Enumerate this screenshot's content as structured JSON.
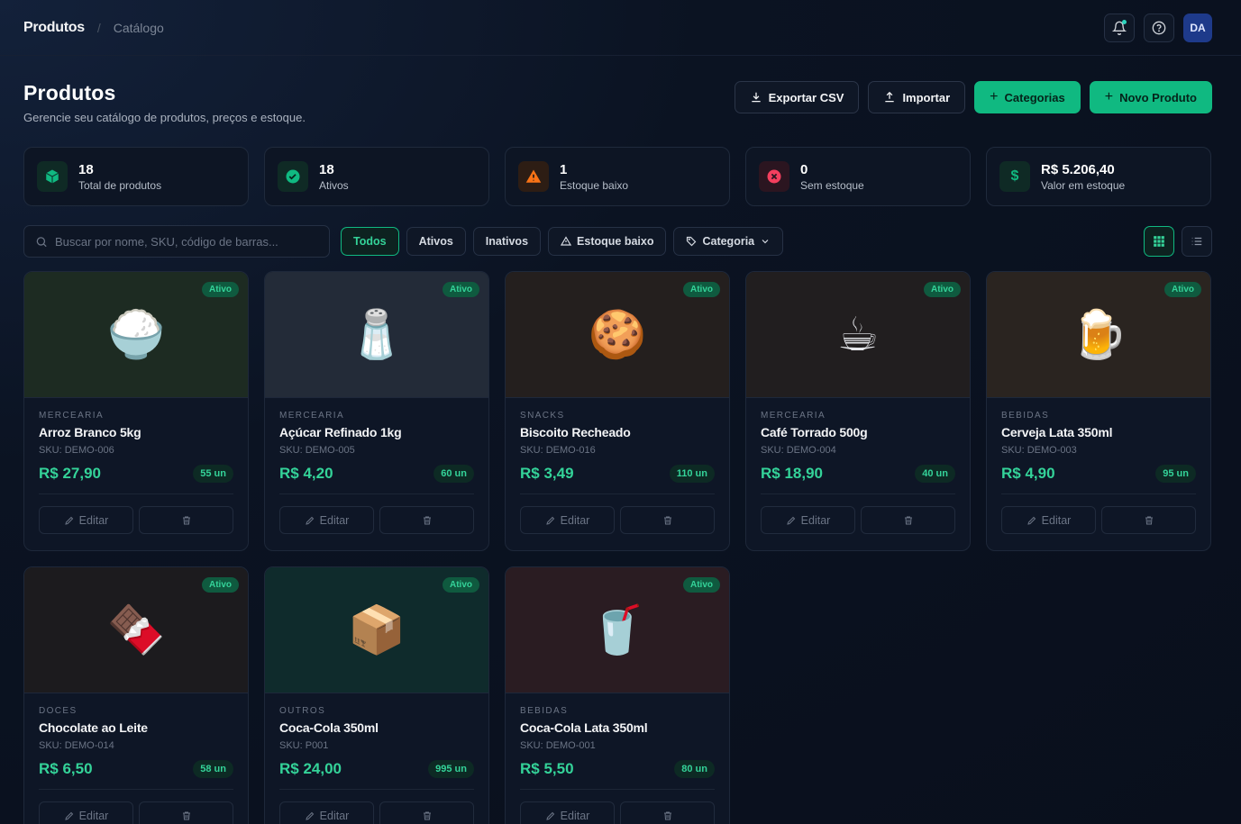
{
  "topbar": {
    "breadcrumb_main": "Produtos",
    "breadcrumb_separator": "/",
    "breadcrumb_sub": "Catálogo",
    "avatar_initials": "DA"
  },
  "header": {
    "title": "Produtos",
    "subtitle": "Gerencie seu catálogo de produtos, preços e estoque.",
    "export_label": "Exportar CSV",
    "import_label": "Importar",
    "categories_label": "Categorias",
    "new_product_label": "Novo Produto"
  },
  "stats": [
    {
      "value": "18",
      "label": "Total de produtos",
      "icon": "box-icon",
      "color": "#10b981"
    },
    {
      "value": "18",
      "label": "Ativos",
      "icon": "check-circle-icon",
      "color": "#10b981"
    },
    {
      "value": "1",
      "label": "Estoque baixo",
      "icon": "warning-icon",
      "color": "#f97316"
    },
    {
      "value": "0",
      "label": "Sem estoque",
      "icon": "x-circle-icon",
      "color": "#f43f5e"
    },
    {
      "value": "R$ 5.206,40",
      "label": "Valor em estoque",
      "icon": "dollar-icon",
      "color": "#10b981"
    }
  ],
  "filters": {
    "search_placeholder": "Buscar por nome, SKU, código de barras...",
    "chips": [
      "Todos",
      "Ativos",
      "Inativos",
      "Estoque baixo",
      "Categoria"
    ],
    "active_chip": "Todos"
  },
  "products": [
    {
      "badge": "Ativo",
      "category": "MERCEARIA",
      "name": "Arroz Branco 5kg",
      "sku": "SKU: DEMO-006",
      "price": "R$ 27,90",
      "stock": "55 un",
      "emoji": "🍚",
      "bg": "#1d2b22"
    },
    {
      "badge": "Ativo",
      "category": "MERCEARIA",
      "name": "Açúcar Refinado 1kg",
      "sku": "SKU: DEMO-005",
      "price": "R$ 4,20",
      "stock": "60 un",
      "emoji": "🧂",
      "bg": "#232b38"
    },
    {
      "badge": "Ativo",
      "category": "SNACKS",
      "name": "Biscoito Recheado",
      "sku": "SKU: DEMO-016",
      "price": "R$ 3,49",
      "stock": "110 un",
      "emoji": "🍪",
      "bg": "#241f1e"
    },
    {
      "badge": "Ativo",
      "category": "MERCEARIA",
      "name": "Café Torrado 500g",
      "sku": "SKU: DEMO-004",
      "price": "R$ 18,90",
      "stock": "40 un",
      "emoji": "☕",
      "bg": "#211e1f"
    },
    {
      "badge": "Ativo",
      "category": "BEBIDAS",
      "name": "Cerveja Lata 350ml",
      "sku": "SKU: DEMO-003",
      "price": "R$ 4,90",
      "stock": "95 un",
      "emoji": "🍺",
      "bg": "#2a2420"
    },
    {
      "badge": "Ativo",
      "category": "DOCES",
      "name": "Chocolate ao Leite",
      "sku": "SKU: DEMO-014",
      "price": "R$ 6,50",
      "stock": "58 un",
      "emoji": "🍫",
      "bg": "#1c1b1e"
    },
    {
      "badge": "Ativo",
      "category": "OUTROS",
      "name": "Coca-Cola 350ml",
      "sku": "SKU: P001",
      "price": "R$ 24,00",
      "stock": "995 un",
      "emoji": "📦",
      "bg": "#0f2b2c"
    },
    {
      "badge": "Ativo",
      "category": "BEBIDAS",
      "name": "Coca-Cola Lata 350ml",
      "sku": "SKU: DEMO-001",
      "price": "R$ 5,50",
      "stock": "80 un",
      "emoji": "🥤",
      "bg": "#2a1c22"
    }
  ],
  "card_actions": {
    "edit_label": "Editar"
  }
}
